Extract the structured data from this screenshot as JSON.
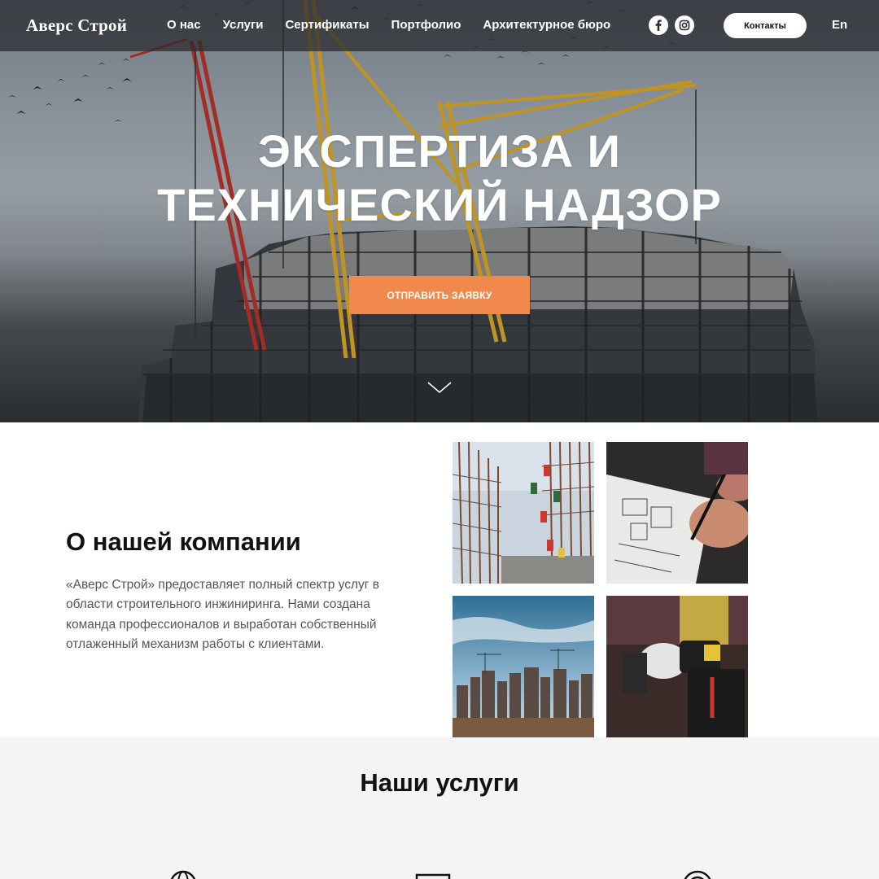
{
  "header": {
    "logo": "Аверс Строй",
    "nav": [
      "О нас",
      "Услуги",
      "Сертификаты",
      "Портфолио",
      "Архитектурное бюро"
    ],
    "social_icons": [
      "facebook-icon",
      "instagram-icon"
    ],
    "contacts_label": "Контакты",
    "language": "En"
  },
  "hero": {
    "title_line1": "ЭКСПЕРТИЗА И",
    "title_line2": "ТЕХНИЧЕСКИЙ НАДЗОР",
    "cta_label": "ОТПРАВИТЬ ЗАЯВКУ",
    "scroll_icon": "chevron-down-icon"
  },
  "about": {
    "title": "О нашей компании",
    "text": "«Аверс Строй» предоставляет полный спектр услуг в области строительного инжиниринга. Нами создана команда профессионалов и выработан собственный отлаженный механизм работы с клиентами."
  },
  "services": {
    "title": "Наши услуги",
    "icons": [
      "globe-icon",
      "document-icon",
      "target-icon"
    ]
  },
  "colors": {
    "accent": "#f0894b",
    "header_bg": "#2a2c30",
    "services_bg": "#f4f4f4",
    "text_muted": "#555555"
  }
}
